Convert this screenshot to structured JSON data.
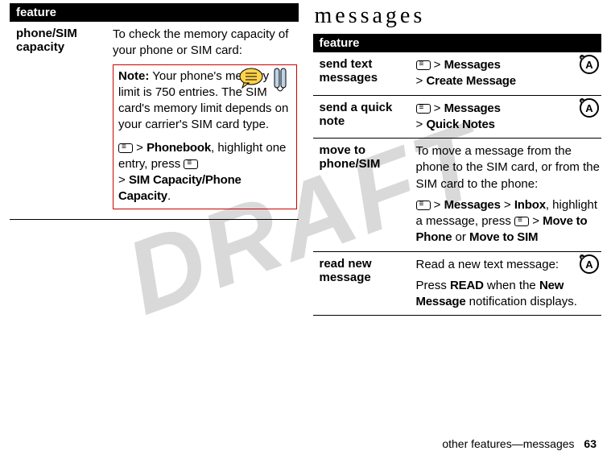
{
  "left_table": {
    "header": "feature",
    "row": {
      "name": "phone/SIM capacity",
      "intro": "To check the memory capacity of your phone or SIM card:",
      "note_label": "Note:",
      "note_body": " Your phone's memory limit is 750 entries. The SIM card's memory limit depends on your carrier's SIM card type.",
      "nav1_a": "Phonebook",
      "nav1_b": ", highlight one entry, press ",
      "nav2": "SIM Capacity/Phone Capacity",
      "nav2_suffix": "."
    }
  },
  "right": {
    "title": "messages",
    "header": "feature",
    "rows": {
      "r1": {
        "name": "send text messages",
        "m1": "Messages",
        "m2": "Create Message"
      },
      "r2": {
        "name": "send a quick note",
        "m1": "Messages",
        "m2": "Quick Notes"
      },
      "r3": {
        "name": "move to phone/SIM",
        "intro": "To move a message from the phone to the SIM card, or from the SIM card to the phone:",
        "m1": "Messages",
        "m2": "Inbox",
        "mid": ", highlight a message, press ",
        "m3": "Move to Phone",
        "or": " or ",
        "m4": "Move to SIM"
      },
      "r4": {
        "name": "read new message",
        "intro": "Read a new text message:",
        "press": "Press ",
        "key": "READ",
        "when": " when the ",
        "notif": "New Message",
        "tail": " notification displays."
      }
    }
  },
  "footer": {
    "text": "other features—messages",
    "page": "63"
  },
  "watermark": "DRAFT"
}
